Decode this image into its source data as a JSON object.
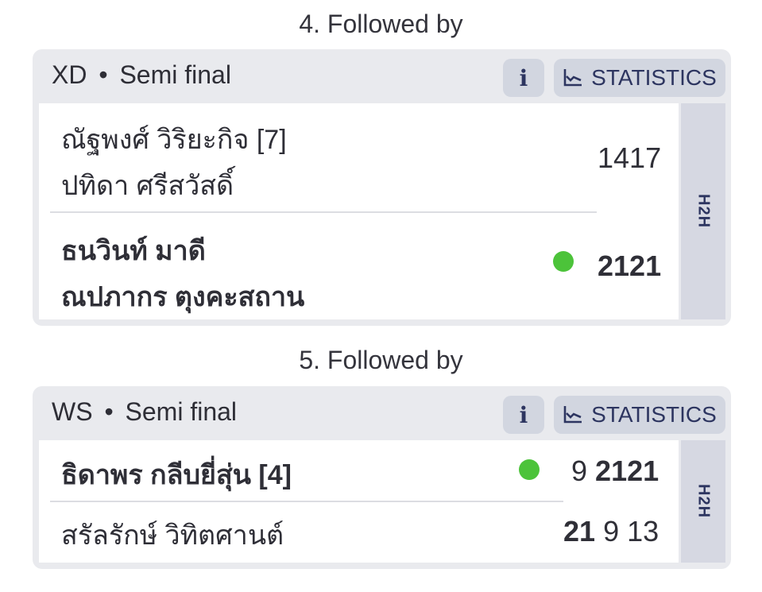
{
  "matches": [
    {
      "heading": "4. Followed by",
      "event": "XD",
      "separator": "•",
      "round": "Semi final",
      "info_label": "i",
      "stats_label": "STATISTICS",
      "h2h_label": "H2H",
      "team1": {
        "players": [
          "ณัฐพงศ์ วิริยะกิจ [7]",
          "ปทิดา ศรีสวัสดิ์"
        ],
        "scores": [
          "14",
          "17"
        ],
        "winner": false
      },
      "team2": {
        "players": [
          "ธนวินท์ มาดี",
          "ณปภากร ตุงคะสถาน"
        ],
        "scores": [
          "21",
          "21"
        ],
        "winner": true
      }
    },
    {
      "heading": "5. Followed by",
      "event": "WS",
      "separator": "•",
      "round": "Semi final",
      "info_label": "i",
      "stats_label": "STATISTICS",
      "h2h_label": "H2H",
      "team1": {
        "players": [
          "ธิดาพร กลีบยี่สุ่น [4]"
        ],
        "scores": [
          "9",
          "21",
          "21"
        ],
        "winner": true
      },
      "team2": {
        "players": [
          "สรัลรักษ์ วิทิตศานต์"
        ],
        "scores": [
          "21",
          "9",
          "13"
        ],
        "winner": false
      }
    }
  ],
  "colors": {
    "card_bg": "#e9eaee",
    "button_bg": "#d2d6e0",
    "accent": "#2d3560",
    "winner_dot": "#4cc33a"
  },
  "icons": {
    "info": "info-icon",
    "stats": "line-chart-icon"
  }
}
